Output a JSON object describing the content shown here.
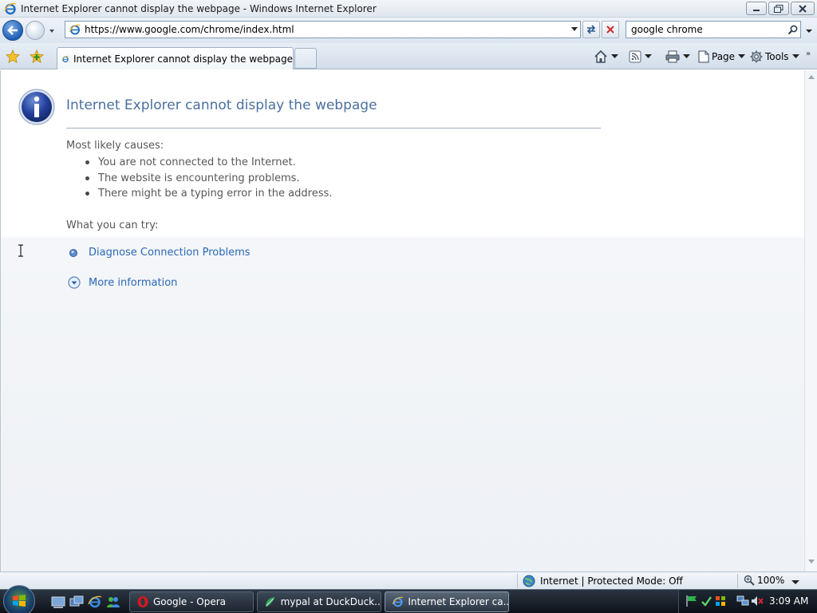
{
  "window": {
    "title": "Internet Explorer cannot display the webpage - Windows Internet Explorer"
  },
  "address_bar": {
    "url": "https://www.google.com/chrome/index.html"
  },
  "search": {
    "value": "google chrome"
  },
  "tabs": [
    {
      "label": "Internet Explorer cannot display the webpage",
      "active": true
    }
  ],
  "command_bar": {
    "page_label": "Page",
    "tools_label": "Tools"
  },
  "error_page": {
    "title": "Internet Explorer cannot display the webpage",
    "causes_heading": "Most likely causes:",
    "causes": [
      "You are not connected to the Internet.",
      "The website is encountering problems.",
      "There might be a typing error in the address."
    ],
    "try_heading": "What you can try:",
    "diagnose_link": "Diagnose Connection Problems",
    "more_info_link": "More information"
  },
  "status_bar": {
    "zone_text": "Internet | Protected Mode: Off",
    "zoom": "100%"
  },
  "taskbar": {
    "buttons": [
      {
        "label": "Google - Opera",
        "active": false
      },
      {
        "label": "mypal at DuckDuck...",
        "active": false
      },
      {
        "label": "Internet Explorer ca...",
        "active": true
      }
    ],
    "clock": "3:09 AM"
  },
  "colors": {
    "link": "#2a68b5",
    "title": "#4b6f9e",
    "body_text": "#575757",
    "taskbar": "#1d252f"
  }
}
